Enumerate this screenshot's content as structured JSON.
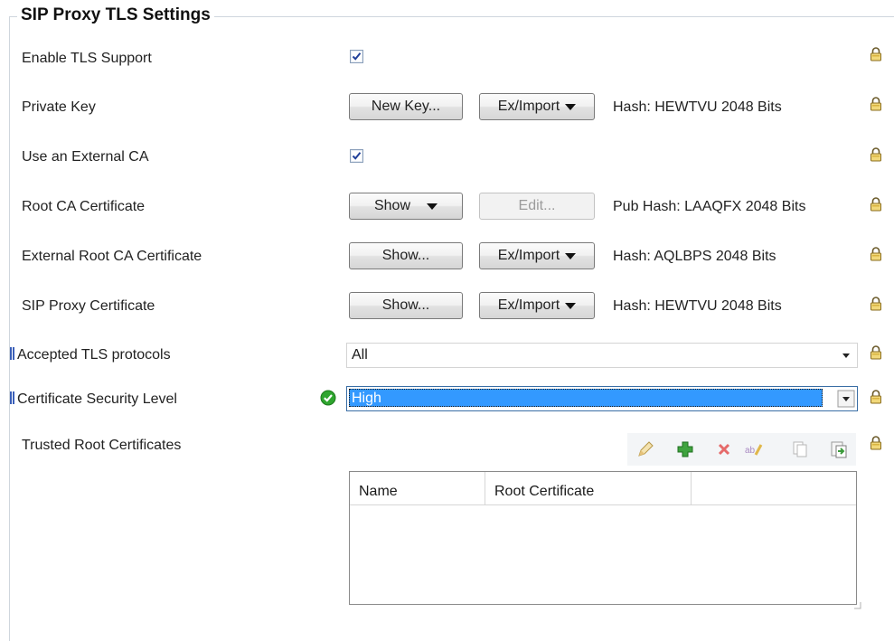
{
  "section": {
    "title": "SIP Proxy TLS Settings"
  },
  "rows": {
    "enable_tls": {
      "label": "Enable TLS Support",
      "checked": true
    },
    "private_key": {
      "label": "Private Key",
      "button1": "New Key...",
      "button2": "Ex/Import",
      "info": "Hash: HEWTVU 2048 Bits"
    },
    "external_ca": {
      "label": "Use an External CA",
      "checked": true
    },
    "root_ca": {
      "label": "Root CA Certificate",
      "button1": "Show",
      "button2": "Edit...",
      "info": "Pub Hash: LAAQFX 2048 Bits"
    },
    "ext_root_ca": {
      "label": "External Root CA Certificate",
      "button1": "Show...",
      "button2": "Ex/Import",
      "info": "Hash: AQLBPS 2048 Bits"
    },
    "sip_proxy_cert": {
      "label": "SIP Proxy Certificate",
      "button1": "Show...",
      "button2": "Ex/Import",
      "info": "Hash: HEWTVU 2048 Bits"
    },
    "accepted_tls": {
      "label": "Accepted TLS protocols",
      "value": "All"
    },
    "cert_security": {
      "label": "Certificate Security Level",
      "value": "High"
    },
    "trusted_roots": {
      "label": "Trusted Root Certificates"
    }
  },
  "table": {
    "columns": [
      "Name",
      "Root Certificate",
      ""
    ],
    "rows": []
  },
  "icons": {
    "lock": "lock-icon",
    "check": "checkmark-icon",
    "toolbar": [
      "edit-icon",
      "add-icon",
      "delete-icon",
      "rename-icon",
      "copy-icon",
      "paste-icon"
    ]
  },
  "colors": {
    "selection": "#3399ff",
    "valid": "#2fa52f",
    "marker": "#3a5fb8"
  }
}
